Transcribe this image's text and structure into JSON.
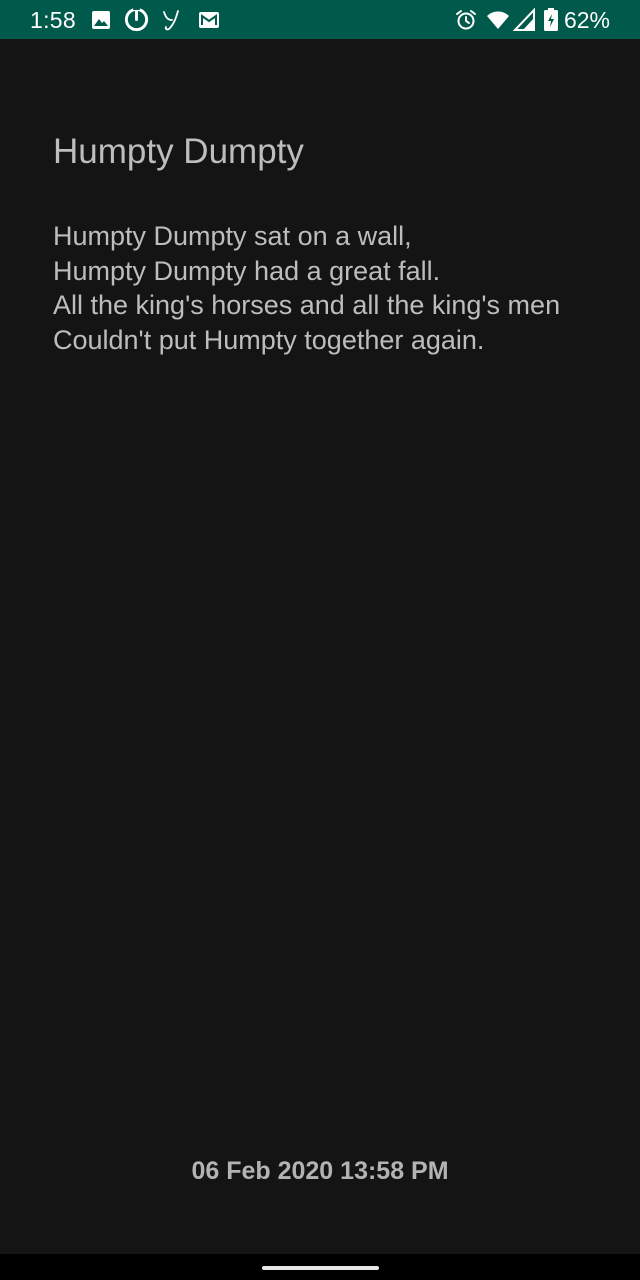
{
  "status_bar": {
    "time": "1:58",
    "battery_percent": "62%",
    "background_color": "#005a4b",
    "left_icons": [
      "image-icon",
      "sync-power-icon",
      "yahoo-y-icon",
      "gmail-icon"
    ],
    "right_icons": [
      "alarm-icon",
      "wifi-icon",
      "cell-signal-icon",
      "battery-charging-icon"
    ]
  },
  "note": {
    "title": "Humpty Dumpty",
    "body_lines": [
      "Humpty Dumpty sat on a wall,",
      "Humpty Dumpty had a great fall.",
      "All the king's horses and all the king's men",
      "Couldn't put Humpty together again."
    ],
    "date": "06 Feb 2020 13:58 PM"
  },
  "colors": {
    "background": "#141414",
    "text": "#bdbdbd"
  }
}
